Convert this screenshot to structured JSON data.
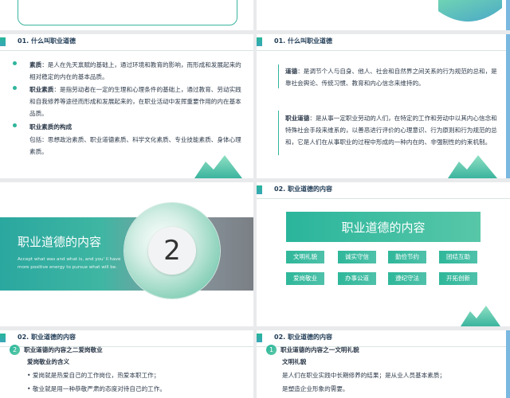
{
  "slide1": {
    "header": "01. 什么叫职业道德",
    "items": [
      {
        "term": "素质",
        "text": "：是人在先天禀赋的基础上，通过环境和教育的影响，而形成和发展起来的相对稳定的内在的基本品质。"
      },
      {
        "term": "职业素质",
        "text": "：是指劳动者在一定的生理和心理条件的基础上，通过教育、劳动实践和自我修养等途径而形成和发展起来的，在职业活动中发挥重要作用的内在基本品质。"
      },
      {
        "term": "职业素质的构成",
        "text": ""
      }
    ],
    "composition": "包括：思想政治素质、职业道德素质、科学文化素质、专业技能素质、身体心理素质。"
  },
  "slide2": {
    "header": "01. 什么叫职业道德",
    "items": [
      {
        "term": "道德",
        "text": "：是调节个人与自身、他人、社会和自然界之间关系的行为规范的总和，是靠社会舆论、传统习惯、教育和内心信念来维持的。"
      },
      {
        "term": "职业道德",
        "text": "：是从事一定职业劳动的人们，在特定的工作和劳动中以其内心信念和特殊社会手段来维系的，以善恶进行评价的心理意识、行为原则和行为规范的总和，它是人们在从事职业的过程中形成的一种内在的、非强制性的约束机制。"
      }
    ]
  },
  "slide3": {
    "title": "职业道德的内容",
    "subtitle": "Accept what was and what is, and you' ll have more positive energy to pursue what will be.",
    "number": "2"
  },
  "slide4": {
    "header": "02. 职业道德的内容",
    "banner": "职业道德的内容",
    "tags": [
      "文明礼貌",
      "诚实守信",
      "勤俭节约",
      "团结互助",
      "爱岗敬业",
      "办事公道",
      "遵纪守法",
      "开拓创新"
    ]
  },
  "slide5": {
    "header": "02. 职业道德的内容",
    "num": "2",
    "heading": "职业道德的内容之二爱岗敬业",
    "sub": "爱岗敬业的含义",
    "lines": [
      "• 爱岗就是热爱自己的工作岗位，热爱本职工作；",
      "• 敬业就是用一种恭敬严肃的态度对待自己的工作。"
    ]
  },
  "slide6": {
    "header": "02. 职业道德的内容",
    "num": "1",
    "heading": "职业道德的内容之一文明礼貌",
    "sub": "文明礼貌",
    "lines": [
      "是人们在职业实践中长期修养的结果；是从业人员基本素质；",
      "是塑造企业形象的需要。"
    ]
  }
}
